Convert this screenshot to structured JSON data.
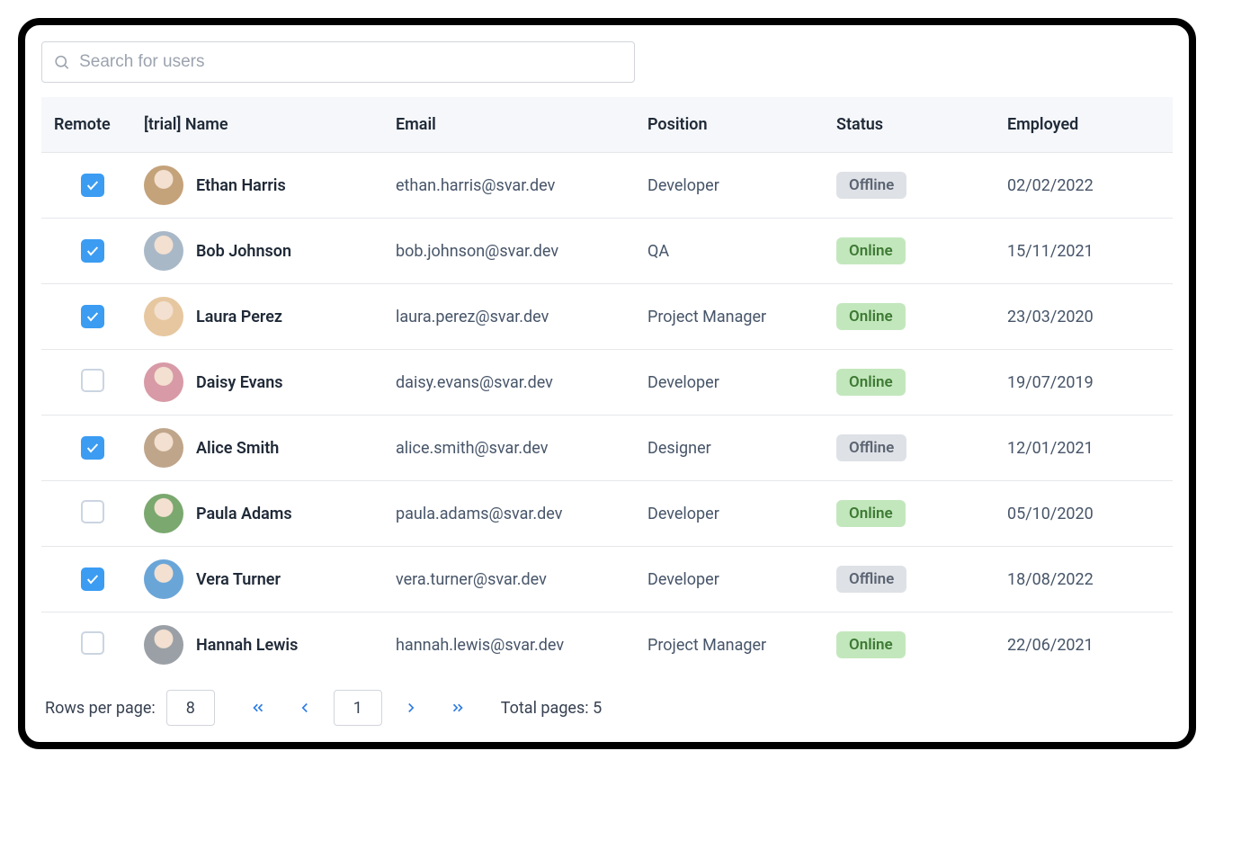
{
  "search": {
    "placeholder": "Search for users"
  },
  "columns": {
    "remote": "Remote",
    "name": "[trial] Name",
    "email": "Email",
    "position": "Position",
    "status": "Status",
    "employed": "Employed"
  },
  "status_labels": {
    "online": "Online",
    "offline": "Offline"
  },
  "rows": [
    {
      "remote": true,
      "name": "Ethan Harris",
      "email": "ethan.harris@svar.dev",
      "position": "Developer",
      "status": "offline",
      "employed": "02/02/2022",
      "avatar": "#c4a27a"
    },
    {
      "remote": true,
      "name": "Bob Johnson",
      "email": "bob.johnson@svar.dev",
      "position": "QA",
      "status": "online",
      "employed": "15/11/2021",
      "avatar": "#a9b8c7"
    },
    {
      "remote": true,
      "name": "Laura Perez",
      "email": "laura.perez@svar.dev",
      "position": "Project Manager",
      "status": "online",
      "employed": "23/03/2020",
      "avatar": "#e6c7a0"
    },
    {
      "remote": false,
      "name": "Daisy Evans",
      "email": "daisy.evans@svar.dev",
      "position": "Developer",
      "status": "online",
      "employed": "19/07/2019",
      "avatar": "#d79aa6"
    },
    {
      "remote": true,
      "name": "Alice Smith",
      "email": "alice.smith@svar.dev",
      "position": "Designer",
      "status": "offline",
      "employed": "12/01/2021",
      "avatar": "#bfa58a"
    },
    {
      "remote": false,
      "name": "Paula Adams",
      "email": "paula.adams@svar.dev",
      "position": "Developer",
      "status": "online",
      "employed": "05/10/2020",
      "avatar": "#7aa86f"
    },
    {
      "remote": true,
      "name": "Vera Turner",
      "email": "vera.turner@svar.dev",
      "position": "Developer",
      "status": "offline",
      "employed": "18/08/2022",
      "avatar": "#6aa5d8"
    },
    {
      "remote": false,
      "name": "Hannah Lewis",
      "email": "hannah.lewis@svar.dev",
      "position": "Project Manager",
      "status": "online",
      "employed": "22/06/2021",
      "avatar": "#9aa0a6"
    }
  ],
  "pager": {
    "rows_per_page_label": "Rows per page:",
    "rows_per_page": "8",
    "current_page": "1",
    "total_pages_label": "Total pages: 5"
  }
}
